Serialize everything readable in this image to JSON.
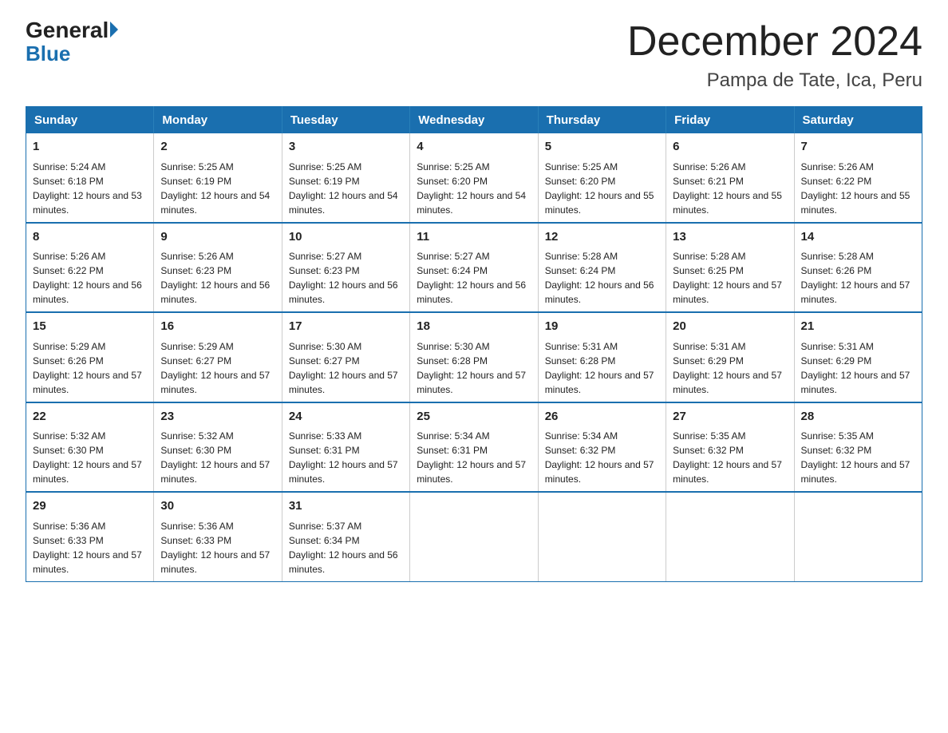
{
  "logo": {
    "general": "General",
    "blue": "Blue"
  },
  "header": {
    "title": "December 2024",
    "subtitle": "Pampa de Tate, Ica, Peru"
  },
  "weekdays": [
    "Sunday",
    "Monday",
    "Tuesday",
    "Wednesday",
    "Thursday",
    "Friday",
    "Saturday"
  ],
  "weeks": [
    [
      {
        "day": "1",
        "sunrise": "5:24 AM",
        "sunset": "6:18 PM",
        "daylight": "12 hours and 53 minutes."
      },
      {
        "day": "2",
        "sunrise": "5:25 AM",
        "sunset": "6:19 PM",
        "daylight": "12 hours and 54 minutes."
      },
      {
        "day": "3",
        "sunrise": "5:25 AM",
        "sunset": "6:19 PM",
        "daylight": "12 hours and 54 minutes."
      },
      {
        "day": "4",
        "sunrise": "5:25 AM",
        "sunset": "6:20 PM",
        "daylight": "12 hours and 54 minutes."
      },
      {
        "day": "5",
        "sunrise": "5:25 AM",
        "sunset": "6:20 PM",
        "daylight": "12 hours and 55 minutes."
      },
      {
        "day": "6",
        "sunrise": "5:26 AM",
        "sunset": "6:21 PM",
        "daylight": "12 hours and 55 minutes."
      },
      {
        "day": "7",
        "sunrise": "5:26 AM",
        "sunset": "6:22 PM",
        "daylight": "12 hours and 55 minutes."
      }
    ],
    [
      {
        "day": "8",
        "sunrise": "5:26 AM",
        "sunset": "6:22 PM",
        "daylight": "12 hours and 56 minutes."
      },
      {
        "day": "9",
        "sunrise": "5:26 AM",
        "sunset": "6:23 PM",
        "daylight": "12 hours and 56 minutes."
      },
      {
        "day": "10",
        "sunrise": "5:27 AM",
        "sunset": "6:23 PM",
        "daylight": "12 hours and 56 minutes."
      },
      {
        "day": "11",
        "sunrise": "5:27 AM",
        "sunset": "6:24 PM",
        "daylight": "12 hours and 56 minutes."
      },
      {
        "day": "12",
        "sunrise": "5:28 AM",
        "sunset": "6:24 PM",
        "daylight": "12 hours and 56 minutes."
      },
      {
        "day": "13",
        "sunrise": "5:28 AM",
        "sunset": "6:25 PM",
        "daylight": "12 hours and 57 minutes."
      },
      {
        "day": "14",
        "sunrise": "5:28 AM",
        "sunset": "6:26 PM",
        "daylight": "12 hours and 57 minutes."
      }
    ],
    [
      {
        "day": "15",
        "sunrise": "5:29 AM",
        "sunset": "6:26 PM",
        "daylight": "12 hours and 57 minutes."
      },
      {
        "day": "16",
        "sunrise": "5:29 AM",
        "sunset": "6:27 PM",
        "daylight": "12 hours and 57 minutes."
      },
      {
        "day": "17",
        "sunrise": "5:30 AM",
        "sunset": "6:27 PM",
        "daylight": "12 hours and 57 minutes."
      },
      {
        "day": "18",
        "sunrise": "5:30 AM",
        "sunset": "6:28 PM",
        "daylight": "12 hours and 57 minutes."
      },
      {
        "day": "19",
        "sunrise": "5:31 AM",
        "sunset": "6:28 PM",
        "daylight": "12 hours and 57 minutes."
      },
      {
        "day": "20",
        "sunrise": "5:31 AM",
        "sunset": "6:29 PM",
        "daylight": "12 hours and 57 minutes."
      },
      {
        "day": "21",
        "sunrise": "5:31 AM",
        "sunset": "6:29 PM",
        "daylight": "12 hours and 57 minutes."
      }
    ],
    [
      {
        "day": "22",
        "sunrise": "5:32 AM",
        "sunset": "6:30 PM",
        "daylight": "12 hours and 57 minutes."
      },
      {
        "day": "23",
        "sunrise": "5:32 AM",
        "sunset": "6:30 PM",
        "daylight": "12 hours and 57 minutes."
      },
      {
        "day": "24",
        "sunrise": "5:33 AM",
        "sunset": "6:31 PM",
        "daylight": "12 hours and 57 minutes."
      },
      {
        "day": "25",
        "sunrise": "5:34 AM",
        "sunset": "6:31 PM",
        "daylight": "12 hours and 57 minutes."
      },
      {
        "day": "26",
        "sunrise": "5:34 AM",
        "sunset": "6:32 PM",
        "daylight": "12 hours and 57 minutes."
      },
      {
        "day": "27",
        "sunrise": "5:35 AM",
        "sunset": "6:32 PM",
        "daylight": "12 hours and 57 minutes."
      },
      {
        "day": "28",
        "sunrise": "5:35 AM",
        "sunset": "6:32 PM",
        "daylight": "12 hours and 57 minutes."
      }
    ],
    [
      {
        "day": "29",
        "sunrise": "5:36 AM",
        "sunset": "6:33 PM",
        "daylight": "12 hours and 57 minutes."
      },
      {
        "day": "30",
        "sunrise": "5:36 AM",
        "sunset": "6:33 PM",
        "daylight": "12 hours and 57 minutes."
      },
      {
        "day": "31",
        "sunrise": "5:37 AM",
        "sunset": "6:34 PM",
        "daylight": "12 hours and 56 minutes."
      },
      null,
      null,
      null,
      null
    ]
  ]
}
